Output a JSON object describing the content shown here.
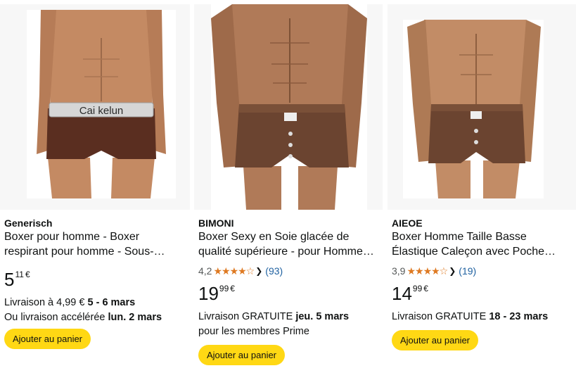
{
  "products": [
    {
      "image_alt": "brown boxer with Cai kelun waistband",
      "waistband_text": "Cai kelun",
      "brand": "Generisch",
      "title": "Boxer pour homme - Boxer respirant pour homme - Sous-…",
      "rating": null,
      "price_whole": "5",
      "price_fraction": "11",
      "currency": "€",
      "delivery_line1_prefix": "Livraison à 4,99 € ",
      "delivery_line1_bold": "5 - 6 mars",
      "delivery_line2_prefix": "Ou livraison accélérée ",
      "delivery_line2_bold": "lun. 2 mars",
      "button_label": "Ajouter au panier"
    },
    {
      "image_alt": "brown boxer with button front",
      "brand": "BIMONI",
      "title": "Boxer Sexy en Soie glacée de qualité supérieure - pour Homme…",
      "rating_value": "4,2",
      "rating_stars": "★★★★☆",
      "rating_count": "(93)",
      "price_whole": "19",
      "price_fraction": "99",
      "currency": "€",
      "delivery_line1_prefix": "Livraison GRATUITE ",
      "delivery_line1_bold": "jeu. 5 mars",
      "delivery_line2_prefix": "pour les membres Prime",
      "delivery_line2_bold": "",
      "button_label": "Ajouter au panier"
    },
    {
      "image_alt": "brown low waist boxer with pouch",
      "brand": "AIEOE",
      "title": "Boxer Homme Taille Basse Élastique Caleçon avec Poche…",
      "rating_value": "3,9",
      "rating_stars": "★★★★☆",
      "rating_count": "(19)",
      "price_whole": "14",
      "price_fraction": "99",
      "currency": "€",
      "delivery_line1_prefix": "Livraison GRATUITE ",
      "delivery_line1_bold": "18 - 23 mars",
      "button_label": "Ajouter au panier"
    }
  ],
  "colors": {
    "button": "#ffd814",
    "star": "#de7921",
    "link": "#2162a1",
    "boxer_brown": "#5a3324",
    "skin": "#c9906a"
  }
}
